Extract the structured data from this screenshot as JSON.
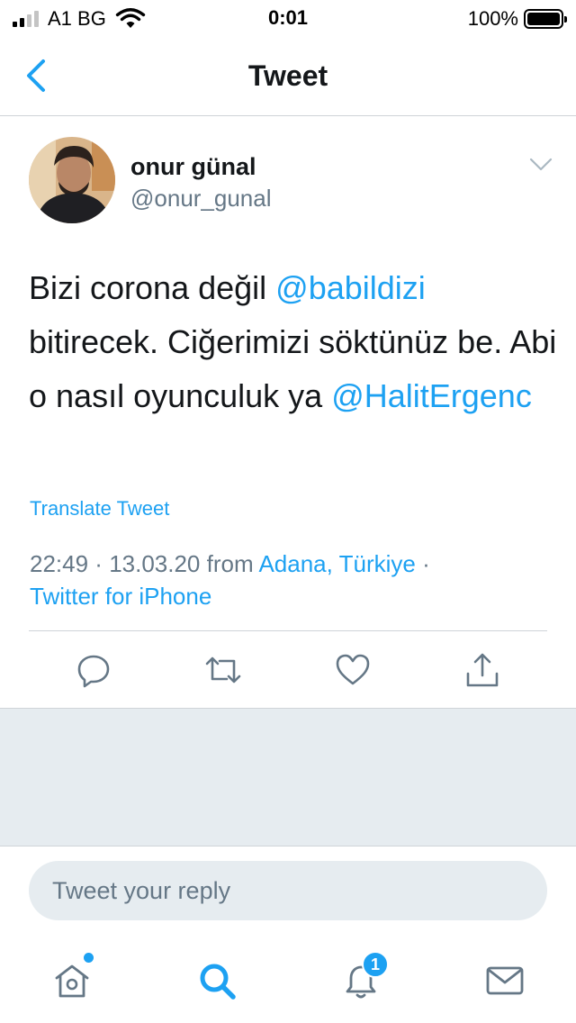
{
  "status_bar": {
    "carrier": "A1 BG",
    "time": "0:01",
    "battery": "100%"
  },
  "nav": {
    "title": "Tweet"
  },
  "tweet": {
    "author_name": "onur günal",
    "author_handle": "@onur_gunal",
    "text_part1": "Bizi corona değil ",
    "mention1": "@babildizi",
    "text_part2": " bitirecek. Ciğerimizi söktünüz be. Abi o nasıl oyunculuk ya ",
    "mention2": "@HalitErgenc",
    "translate_label": "Translate Tweet",
    "time": "22:49",
    "date": "13.03.20",
    "from_label": "from",
    "location": "Adana, Türkiye",
    "source": "Twitter for iPhone"
  },
  "actions": {
    "icons": [
      "reply-icon",
      "retweet-icon",
      "like-icon",
      "share-icon"
    ]
  },
  "reply": {
    "placeholder": "Tweet your reply"
  },
  "tab_bar": {
    "icons": [
      "home-icon",
      "search-icon",
      "notifications-icon",
      "messages-icon"
    ],
    "notification_count": "1"
  },
  "colors": {
    "accent": "#1da1f2",
    "secondary_text": "#657786",
    "background_gray": "#e6ecf0"
  }
}
